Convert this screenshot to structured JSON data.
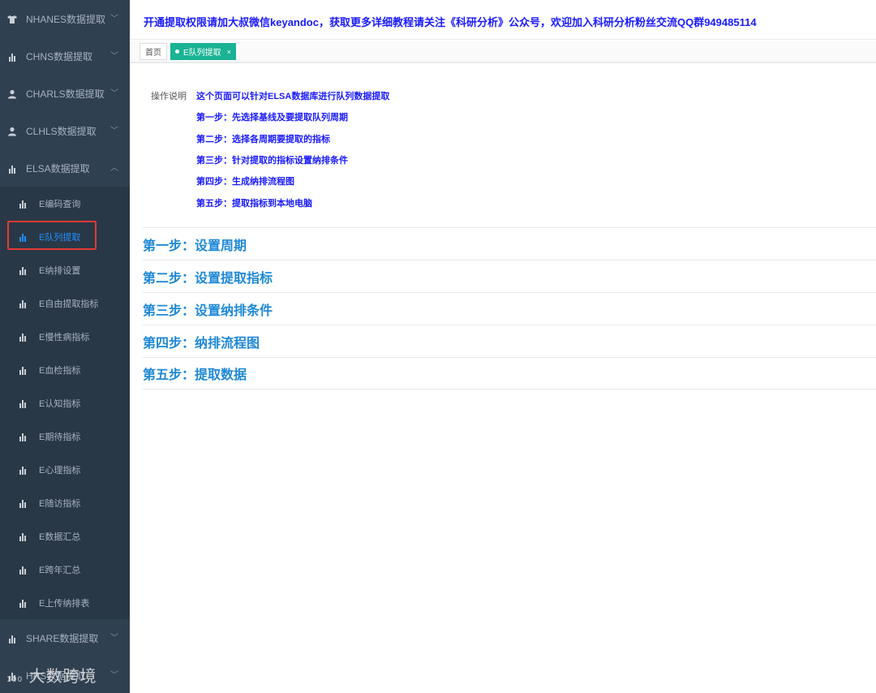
{
  "sidebar": {
    "menus_top": [
      {
        "label": "NHANES数据提取",
        "icon": "shirt-icon"
      },
      {
        "label": "CHNS数据提取",
        "icon": "bar-chart-icon"
      },
      {
        "label": "CHARLS数据提取",
        "icon": "user-icon"
      },
      {
        "label": "CLHLS数据提取",
        "icon": "user-icon"
      },
      {
        "label": "ELSA数据提取",
        "icon": "bar-chart-icon"
      }
    ],
    "submenu": [
      {
        "label": "E编码查询"
      },
      {
        "label": "E队列提取"
      },
      {
        "label": "E纳排设置"
      },
      {
        "label": "E自由提取指标"
      },
      {
        "label": "E慢性病指标"
      },
      {
        "label": "E血检指标"
      },
      {
        "label": "E认知指标"
      },
      {
        "label": "E期待指标"
      },
      {
        "label": "E心理指标"
      },
      {
        "label": "E随访指标"
      },
      {
        "label": "E数据汇总"
      },
      {
        "label": "E跨年汇总"
      },
      {
        "label": "E上传纳排表"
      }
    ],
    "menus_bottom": [
      {
        "label": "SHARE数据提取",
        "icon": "bar-chart-icon"
      },
      {
        "label": "HRS数据提取",
        "icon": "bar-chart-icon"
      }
    ],
    "watermark": "大数跨境",
    "watermark_num": "100"
  },
  "header": {
    "notice": "开通提取权限请加大叔微信keyandoc，获取更多详细教程请关注《科研分析》公众号，欢迎加入科研分析粉丝交流QQ群949485114"
  },
  "tabs": {
    "home": "首页",
    "active": "E队列提取",
    "close": "×"
  },
  "instructions": {
    "label": "操作说明",
    "lines": [
      "这个页面可以针对ELSA数据库进行队列数据提取",
      "第一步：先选择基线及要提取队列周期",
      "第二步：选择各周期要提取的指标",
      "第三步：针对提取的指标设置纳排条件",
      "第四步：生成纳排流程图",
      "第五步：提取指标到本地电脑"
    ]
  },
  "steps": [
    "第一步：设置周期",
    "第二步：设置提取指标",
    "第三步：设置纳排条件",
    "第四步：纳排流程图",
    "第五步：提取数据"
  ],
  "colors": {
    "sidebar_bg": "#2f4050",
    "submenu_bg": "#293846",
    "accent_green": "#1ab394",
    "link_blue": "#1a1aff",
    "step_blue": "#1e88d6",
    "highlight_red": "#e53935"
  }
}
